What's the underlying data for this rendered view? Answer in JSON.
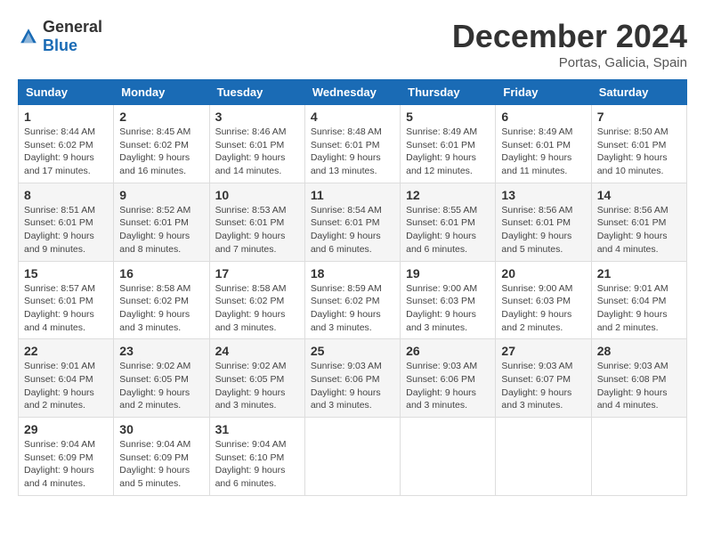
{
  "logo": {
    "general": "General",
    "blue": "Blue"
  },
  "title": "December 2024",
  "location": "Portas, Galicia, Spain",
  "weekdays": [
    "Sunday",
    "Monday",
    "Tuesday",
    "Wednesday",
    "Thursday",
    "Friday",
    "Saturday"
  ],
  "weeks": [
    [
      {
        "day": "1",
        "info": "Sunrise: 8:44 AM\nSunset: 6:02 PM\nDaylight: 9 hours and 17 minutes."
      },
      {
        "day": "2",
        "info": "Sunrise: 8:45 AM\nSunset: 6:02 PM\nDaylight: 9 hours and 16 minutes."
      },
      {
        "day": "3",
        "info": "Sunrise: 8:46 AM\nSunset: 6:01 PM\nDaylight: 9 hours and 14 minutes."
      },
      {
        "day": "4",
        "info": "Sunrise: 8:48 AM\nSunset: 6:01 PM\nDaylight: 9 hours and 13 minutes."
      },
      {
        "day": "5",
        "info": "Sunrise: 8:49 AM\nSunset: 6:01 PM\nDaylight: 9 hours and 12 minutes."
      },
      {
        "day": "6",
        "info": "Sunrise: 8:49 AM\nSunset: 6:01 PM\nDaylight: 9 hours and 11 minutes."
      },
      {
        "day": "7",
        "info": "Sunrise: 8:50 AM\nSunset: 6:01 PM\nDaylight: 9 hours and 10 minutes."
      }
    ],
    [
      {
        "day": "8",
        "info": "Sunrise: 8:51 AM\nSunset: 6:01 PM\nDaylight: 9 hours and 9 minutes."
      },
      {
        "day": "9",
        "info": "Sunrise: 8:52 AM\nSunset: 6:01 PM\nDaylight: 9 hours and 8 minutes."
      },
      {
        "day": "10",
        "info": "Sunrise: 8:53 AM\nSunset: 6:01 PM\nDaylight: 9 hours and 7 minutes."
      },
      {
        "day": "11",
        "info": "Sunrise: 8:54 AM\nSunset: 6:01 PM\nDaylight: 9 hours and 6 minutes."
      },
      {
        "day": "12",
        "info": "Sunrise: 8:55 AM\nSunset: 6:01 PM\nDaylight: 9 hours and 6 minutes."
      },
      {
        "day": "13",
        "info": "Sunrise: 8:56 AM\nSunset: 6:01 PM\nDaylight: 9 hours and 5 minutes."
      },
      {
        "day": "14",
        "info": "Sunrise: 8:56 AM\nSunset: 6:01 PM\nDaylight: 9 hours and 4 minutes."
      }
    ],
    [
      {
        "day": "15",
        "info": "Sunrise: 8:57 AM\nSunset: 6:01 PM\nDaylight: 9 hours and 4 minutes."
      },
      {
        "day": "16",
        "info": "Sunrise: 8:58 AM\nSunset: 6:02 PM\nDaylight: 9 hours and 3 minutes."
      },
      {
        "day": "17",
        "info": "Sunrise: 8:58 AM\nSunset: 6:02 PM\nDaylight: 9 hours and 3 minutes."
      },
      {
        "day": "18",
        "info": "Sunrise: 8:59 AM\nSunset: 6:02 PM\nDaylight: 9 hours and 3 minutes."
      },
      {
        "day": "19",
        "info": "Sunrise: 9:00 AM\nSunset: 6:03 PM\nDaylight: 9 hours and 3 minutes."
      },
      {
        "day": "20",
        "info": "Sunrise: 9:00 AM\nSunset: 6:03 PM\nDaylight: 9 hours and 2 minutes."
      },
      {
        "day": "21",
        "info": "Sunrise: 9:01 AM\nSunset: 6:04 PM\nDaylight: 9 hours and 2 minutes."
      }
    ],
    [
      {
        "day": "22",
        "info": "Sunrise: 9:01 AM\nSunset: 6:04 PM\nDaylight: 9 hours and 2 minutes."
      },
      {
        "day": "23",
        "info": "Sunrise: 9:02 AM\nSunset: 6:05 PM\nDaylight: 9 hours and 2 minutes."
      },
      {
        "day": "24",
        "info": "Sunrise: 9:02 AM\nSunset: 6:05 PM\nDaylight: 9 hours and 3 minutes."
      },
      {
        "day": "25",
        "info": "Sunrise: 9:03 AM\nSunset: 6:06 PM\nDaylight: 9 hours and 3 minutes."
      },
      {
        "day": "26",
        "info": "Sunrise: 9:03 AM\nSunset: 6:06 PM\nDaylight: 9 hours and 3 minutes."
      },
      {
        "day": "27",
        "info": "Sunrise: 9:03 AM\nSunset: 6:07 PM\nDaylight: 9 hours and 3 minutes."
      },
      {
        "day": "28",
        "info": "Sunrise: 9:03 AM\nSunset: 6:08 PM\nDaylight: 9 hours and 4 minutes."
      }
    ],
    [
      {
        "day": "29",
        "info": "Sunrise: 9:04 AM\nSunset: 6:09 PM\nDaylight: 9 hours and 4 minutes."
      },
      {
        "day": "30",
        "info": "Sunrise: 9:04 AM\nSunset: 6:09 PM\nDaylight: 9 hours and 5 minutes."
      },
      {
        "day": "31",
        "info": "Sunrise: 9:04 AM\nSunset: 6:10 PM\nDaylight: 9 hours and 6 minutes."
      },
      null,
      null,
      null,
      null
    ]
  ]
}
